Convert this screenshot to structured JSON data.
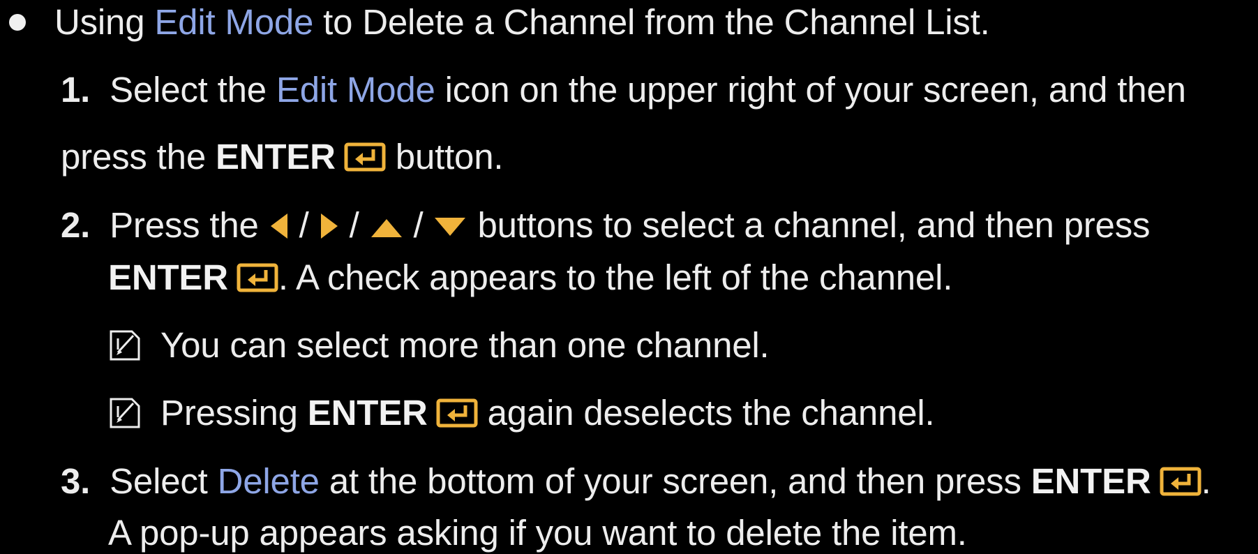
{
  "colors": {
    "highlight": "#8ea6e6",
    "icon": "#f0b33b",
    "text": "#ededed",
    "background": "#000000"
  },
  "bullet": {
    "pre": "Using ",
    "edit_mode": "Edit Mode",
    "post": " to Delete a Channel from the Channel List."
  },
  "step1": {
    "num": "1.",
    "pre": "Select the ",
    "edit_mode": "Edit Mode",
    "post": " icon on the upper right of your screen, and then",
    "cont_pre": "press the ",
    "enter": "ENTER",
    "cont_post": " button."
  },
  "step2": {
    "num": "2.",
    "pre": "Press the ",
    "sep1": " / ",
    "sep2": " / ",
    "sep3": " / ",
    "post": " buttons to select a channel, and then press",
    "enter": "ENTER",
    "cont_post": ". A check appears to the left of the channel."
  },
  "note1": {
    "text": "You can select more than one channel."
  },
  "note2": {
    "pre": "Pressing ",
    "enter": "ENTER",
    "post": " again deselects the channel."
  },
  "step3": {
    "num": "3.",
    "pre": "Select ",
    "delete": "Delete",
    "mid": " at the bottom of your screen, and then press ",
    "enter": "ENTER",
    "end": ".",
    "cont": "A pop-up appears asking if you want to delete the item."
  },
  "icons": [
    "enter-icon",
    "left-arrow-icon",
    "right-arrow-icon",
    "up-arrow-icon",
    "down-arrow-icon",
    "note-icon"
  ]
}
